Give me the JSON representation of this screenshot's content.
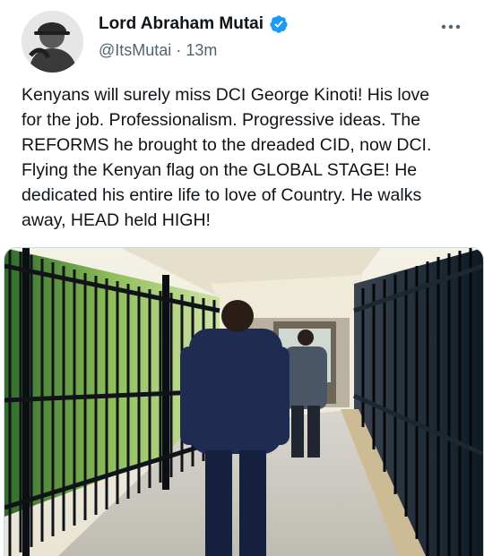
{
  "author": {
    "display_name": "Lord Abraham Mutai",
    "handle": "@ItsMutai",
    "separator": "·",
    "time_ago": "13m",
    "verified_badge_icon": "verified-badge-icon",
    "avatar_icon": "profile-avatar"
  },
  "tweet": {
    "text": "Kenyans will surely miss DCI George Kinoti! His love\nfor the job. Professionalism. Progressive ideas. The\nREFORMS he brought to the dreaded CID, now DCI.\nFlying the Kenyan flag on the GLOBAL STAGE! He\ndedicated his entire life to love of Country. He walks\naway, HEAD held HIGH!"
  },
  "menu": {
    "icon": "more-options-icon"
  },
  "colors": {
    "text_primary": "#0f1419",
    "text_secondary": "#536471",
    "verified_blue": "#1d9bf0",
    "border": "#cfd9de"
  }
}
